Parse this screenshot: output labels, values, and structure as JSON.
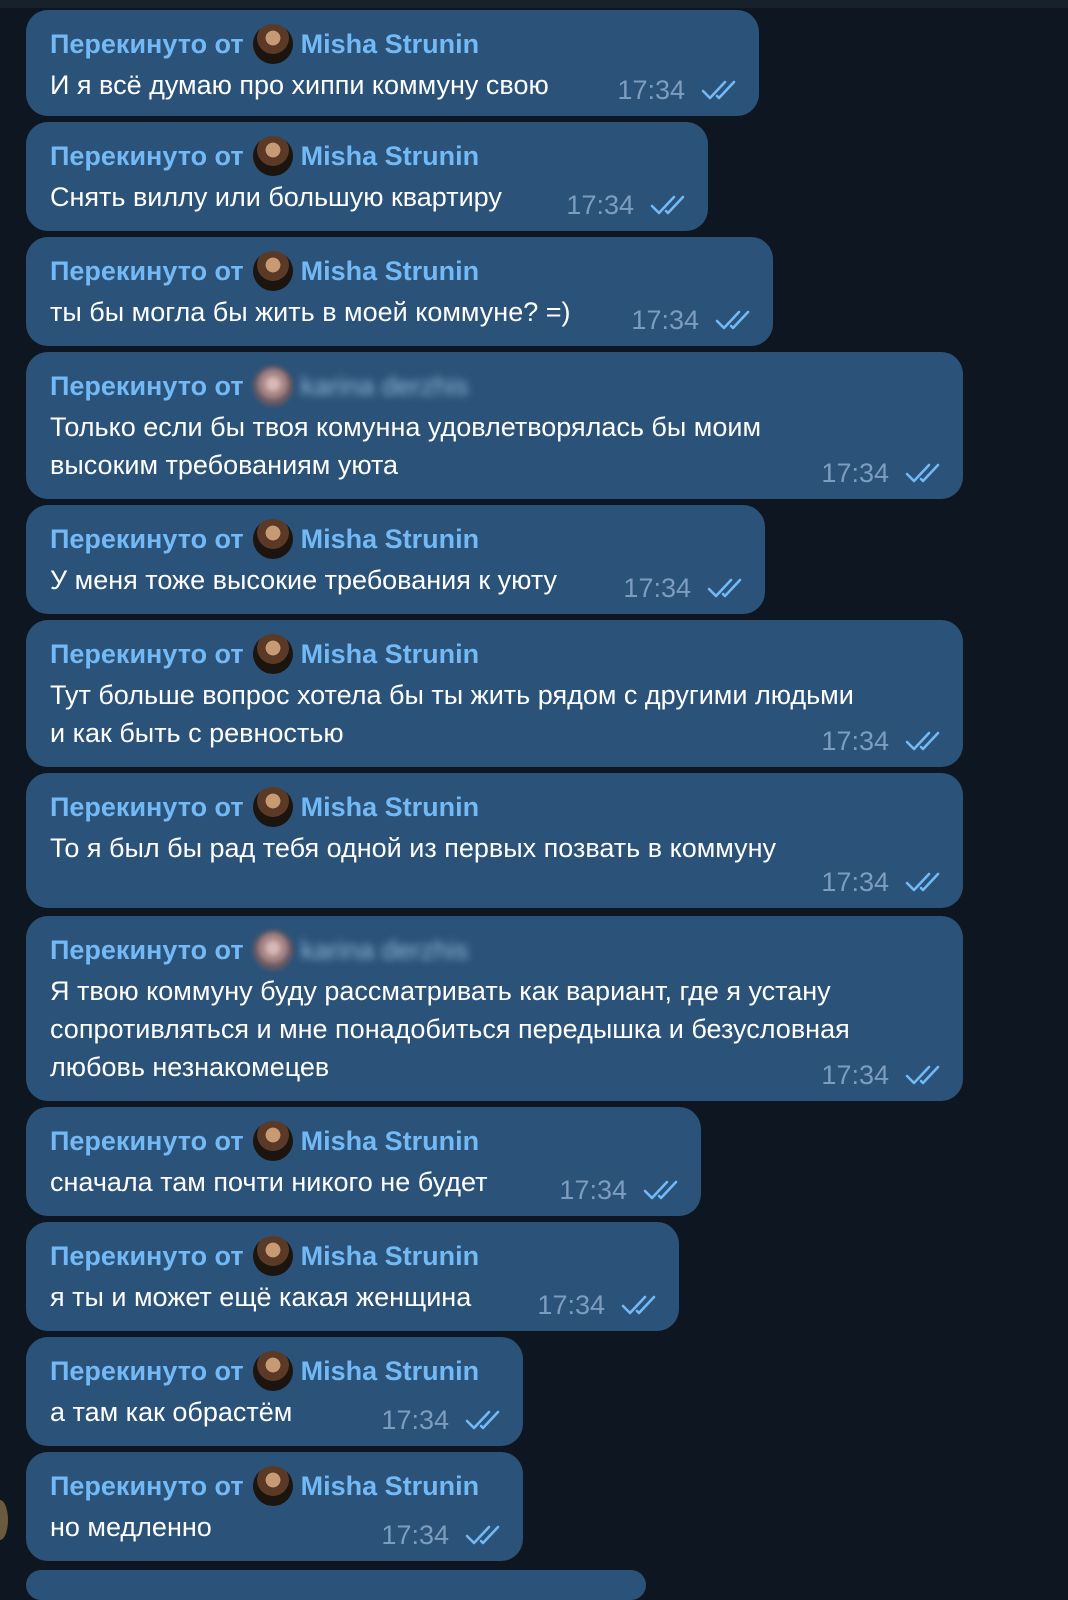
{
  "chat": {
    "forward_prefix": "Перекинуто от",
    "messages": [
      {
        "sender": "Misha Strunin",
        "text": "И я всё думаю про хиппи коммуну свою",
        "time": "17:34",
        "status": "read"
      },
      {
        "sender": "Misha Strunin",
        "text": "Снять виллу или большую квартиру",
        "time": "17:34",
        "status": "read"
      },
      {
        "sender": "Misha Strunin",
        "text": "ты бы могла бы жить в моей коммуне? =)",
        "time": "17:34",
        "status": "read"
      },
      {
        "sender": "karina derzhis",
        "text": "Только если бы твоя комунна удовлетворялась бы моим\nвысоким требованиям уюта",
        "time": "17:34",
        "status": "read"
      },
      {
        "sender": "Misha Strunin",
        "text": "У меня тоже высокие требования к уюту",
        "time": "17:34",
        "status": "read"
      },
      {
        "sender": "Misha Strunin",
        "text": "Тут больше вопрос хотела бы ты жить рядом с другими людьми\nи как быть с ревностью",
        "time": "17:34",
        "status": "read"
      },
      {
        "sender": "Misha Strunin",
        "text": "То я был бы рад тебя одной из первых позвать в коммуну",
        "time": "17:34",
        "status": "read"
      },
      {
        "sender": "karina derzhis",
        "text": "Я твою коммуну буду рассматривать как вариант, где я устану\nсопротивляться и мне понадобиться передышка и безусловная\nлюбовь незнакомецев",
        "time": "17:34",
        "status": "read"
      },
      {
        "sender": "Misha Strunin",
        "text": "сначала там почти никого не будет",
        "time": "17:34",
        "status": "read"
      },
      {
        "sender": "Misha Strunin",
        "text": "я ты и может ещё какая женщина",
        "time": "17:34",
        "status": "read"
      },
      {
        "sender": "Misha Strunin",
        "text": "а там как обрастём",
        "time": "17:34",
        "status": "read"
      },
      {
        "sender": "Misha Strunin",
        "text": "но медленно",
        "time": "17:34",
        "status": "read"
      }
    ]
  },
  "colors": {
    "background": "#0e1621",
    "bubble": "#2b5278",
    "forward_name": "#73b9f5",
    "message_text": "#ffffff",
    "time": "#7d9dbf",
    "read_checks": "#73b9f5"
  }
}
